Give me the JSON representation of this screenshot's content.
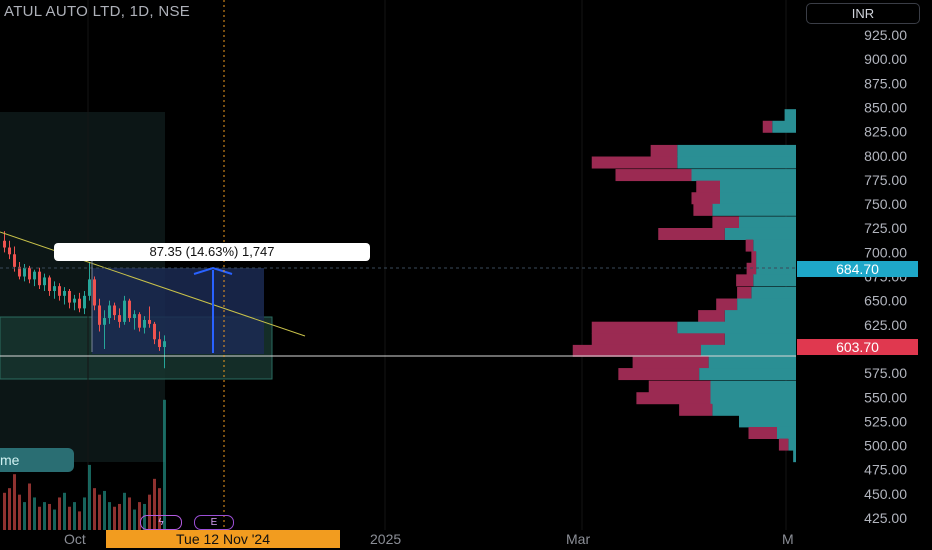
{
  "header": {
    "symbol_title": "ATUL AUTO LTD, 1D, NSE",
    "currency": "INR"
  },
  "measure_tool": {
    "label": "87.35 (14.63%) 1,747"
  },
  "indicator_pill": {
    "label": "me"
  },
  "crosshair": {
    "date_label": "Tue 12 Nov '24"
  },
  "x_axis": {
    "labels": [
      "Oct",
      "2025",
      "Mar",
      "M"
    ]
  },
  "badges": {
    "lightning": "ϟ",
    "earnings": "E"
  },
  "price_tags": {
    "target": "684.70",
    "last": "603.70"
  },
  "colors": {
    "background": "#000000",
    "up": "#26a69a",
    "down": "#ef5350",
    "vp_up": "#2a8f94",
    "vp_down": "#9b2a52",
    "measure_arrow": "#2962ff",
    "crosshair": "#f29c1f",
    "target_tag": "#1ea7c8",
    "last_tag": "#e0384f"
  },
  "chart_data": {
    "type": "candlestick",
    "y_ticks": [
      925,
      900,
      875,
      850,
      825,
      800,
      775,
      750,
      725,
      700,
      675,
      650,
      625,
      600,
      575,
      550,
      525,
      500,
      475,
      450,
      425
    ],
    "ylim": [
      415,
      945
    ],
    "last_price": 603.7,
    "target_price": 684.7,
    "volume_profile": [
      {
        "price": 842,
        "up": 12,
        "down": 0
      },
      {
        "price": 830,
        "up": 25,
        "down": 10
      },
      {
        "price": 805,
        "up": 125,
        "down": 28
      },
      {
        "price": 793,
        "up": 125,
        "down": 90
      },
      {
        "price": 780,
        "up": 110,
        "down": 80
      },
      {
        "price": 768,
        "up": 80,
        "down": 25
      },
      {
        "price": 756,
        "up": 80,
        "down": 30
      },
      {
        "price": 744,
        "up": 88,
        "down": 20
      },
      {
        "price": 731,
        "up": 60,
        "down": 28
      },
      {
        "price": 719,
        "up": 75,
        "down": 70
      },
      {
        "price": 707,
        "up": 45,
        "down": 8
      },
      {
        "price": 695,
        "up": 42,
        "down": 5
      },
      {
        "price": 683,
        "up": 42,
        "down": 10
      },
      {
        "price": 671,
        "up": 45,
        "down": 18
      },
      {
        "price": 658,
        "up": 47,
        "down": 15
      },
      {
        "price": 646,
        "up": 62,
        "down": 22
      },
      {
        "price": 634,
        "up": 75,
        "down": 28
      },
      {
        "price": 622,
        "up": 125,
        "down": 90
      },
      {
        "price": 610,
        "up": 75,
        "down": 140
      },
      {
        "price": 598,
        "up": 100,
        "down": 135
      },
      {
        "price": 586,
        "up": 92,
        "down": 80
      },
      {
        "price": 574,
        "up": 102,
        "down": 85
      },
      {
        "price": 561,
        "up": 90,
        "down": 65
      },
      {
        "price": 549,
        "up": 90,
        "down": 78
      },
      {
        "price": 537,
        "up": 88,
        "down": 35
      },
      {
        "price": 525,
        "up": 60,
        "down": 0
      },
      {
        "price": 513,
        "up": 20,
        "down": 30
      },
      {
        "price": 501,
        "up": 8,
        "down": 10
      },
      {
        "price": 489,
        "up": 3,
        "down": 0
      }
    ],
    "candles": [
      {
        "o": 712,
        "h": 722,
        "l": 700,
        "c": 705
      },
      {
        "o": 705,
        "h": 712,
        "l": 693,
        "c": 698
      },
      {
        "o": 698,
        "h": 706,
        "l": 680,
        "c": 685
      },
      {
        "o": 685,
        "h": 690,
        "l": 672,
        "c": 675
      },
      {
        "o": 675,
        "h": 688,
        "l": 670,
        "c": 684
      },
      {
        "o": 684,
        "h": 686,
        "l": 668,
        "c": 672
      },
      {
        "o": 672,
        "h": 682,
        "l": 665,
        "c": 680
      },
      {
        "o": 680,
        "h": 684,
        "l": 662,
        "c": 666
      },
      {
        "o": 666,
        "h": 678,
        "l": 660,
        "c": 674
      },
      {
        "o": 674,
        "h": 676,
        "l": 655,
        "c": 660
      },
      {
        "o": 660,
        "h": 670,
        "l": 652,
        "c": 665
      },
      {
        "o": 665,
        "h": 668,
        "l": 650,
        "c": 655
      },
      {
        "o": 655,
        "h": 664,
        "l": 646,
        "c": 660
      },
      {
        "o": 660,
        "h": 662,
        "l": 642,
        "c": 648
      },
      {
        "o": 648,
        "h": 656,
        "l": 640,
        "c": 652
      },
      {
        "o": 652,
        "h": 658,
        "l": 638,
        "c": 642
      },
      {
        "o": 642,
        "h": 660,
        "l": 636,
        "c": 655
      },
      {
        "o": 655,
        "h": 690,
        "l": 650,
        "c": 672
      },
      {
        "o": 672,
        "h": 675,
        "l": 640,
        "c": 645
      },
      {
        "o": 645,
        "h": 652,
        "l": 618,
        "c": 625
      },
      {
        "o": 625,
        "h": 640,
        "l": 600,
        "c": 632
      },
      {
        "o": 632,
        "h": 650,
        "l": 626,
        "c": 645
      },
      {
        "o": 645,
        "h": 648,
        "l": 630,
        "c": 635
      },
      {
        "o": 635,
        "h": 642,
        "l": 622,
        "c": 628
      },
      {
        "o": 628,
        "h": 655,
        "l": 625,
        "c": 650
      },
      {
        "o": 650,
        "h": 652,
        "l": 628,
        "c": 632
      },
      {
        "o": 632,
        "h": 640,
        "l": 620,
        "c": 636
      },
      {
        "o": 636,
        "h": 638,
        "l": 618,
        "c": 622
      },
      {
        "o": 622,
        "h": 634,
        "l": 616,
        "c": 630
      },
      {
        "o": 630,
        "h": 644,
        "l": 622,
        "c": 626
      },
      {
        "o": 626,
        "h": 628,
        "l": 605,
        "c": 610
      },
      {
        "o": 610,
        "h": 618,
        "l": 598,
        "c": 602
      },
      {
        "o": 602,
        "h": 614,
        "l": 580,
        "c": 608
      }
    ],
    "volumes": [
      40,
      45,
      60,
      38,
      30,
      50,
      35,
      25,
      30,
      28,
      22,
      35,
      40,
      25,
      30,
      20,
      35,
      70,
      45,
      38,
      42,
      30,
      25,
      28,
      40,
      35,
      22,
      30,
      28,
      38,
      55,
      45,
      140
    ]
  }
}
